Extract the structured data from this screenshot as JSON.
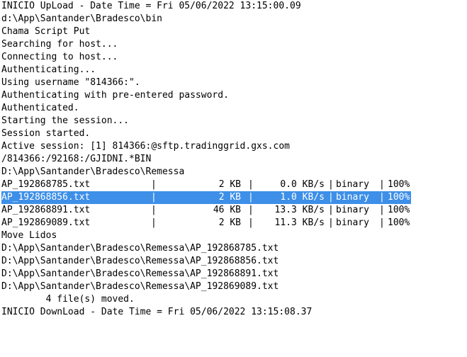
{
  "lines_before": [
    "INICIO UpLoad - Date Time = Fri 05/06/2022 13:15:00.09",
    "d:\\App\\Santander\\Bradesco\\bin",
    "Chama Script Put",
    "Searching for host...",
    "Connecting to host...",
    "Authenticating...",
    "Using username \"814366:\".",
    "Authenticating with pre-entered password.",
    "Authenticated.",
    "Starting the session...",
    "Session started.",
    "Active session: [1] 814366:@sftp.tradinggrid.gxs.com",
    "/814366:/92168:/GJIDNI.*BIN",
    "D:\\App\\Santander\\Bradesco\\Remessa"
  ],
  "transfers": [
    {
      "name": "AP_192868785.txt",
      "size": "2 KB",
      "rate": "0.0 KB/s",
      "mode": "binary",
      "pct": "100%",
      "selected": false
    },
    {
      "name": "AP_192868856.txt",
      "size": "2 KB",
      "rate": "1.0 KB/s",
      "mode": "binary",
      "pct": "100%",
      "selected": true
    },
    {
      "name": "AP_192868891.txt",
      "size": "46 KB",
      "rate": "13.3 KB/s",
      "mode": "binary",
      "pct": "100%",
      "selected": false
    },
    {
      "name": "AP_192869089.txt",
      "size": "2 KB",
      "rate": "11.3 KB/s",
      "mode": "binary",
      "pct": "100%",
      "selected": false
    }
  ],
  "separator": "|",
  "lines_after": [
    "Move Lidos",
    "D:\\App\\Santander\\Bradesco\\Remessa\\AP_192868785.txt",
    "D:\\App\\Santander\\Bradesco\\Remessa\\AP_192868856.txt",
    "D:\\App\\Santander\\Bradesco\\Remessa\\AP_192868891.txt",
    "D:\\App\\Santander\\Bradesco\\Remessa\\AP_192869089.txt",
    "        4 file(s) moved.",
    "INICIO DownLoad - Date Time = Fri 05/06/2022 13:15:08.37"
  ],
  "colors": {
    "background": "#ffffff",
    "text": "#000000",
    "selection": "#3d8fe8",
    "selection_text": "#ffffff"
  }
}
